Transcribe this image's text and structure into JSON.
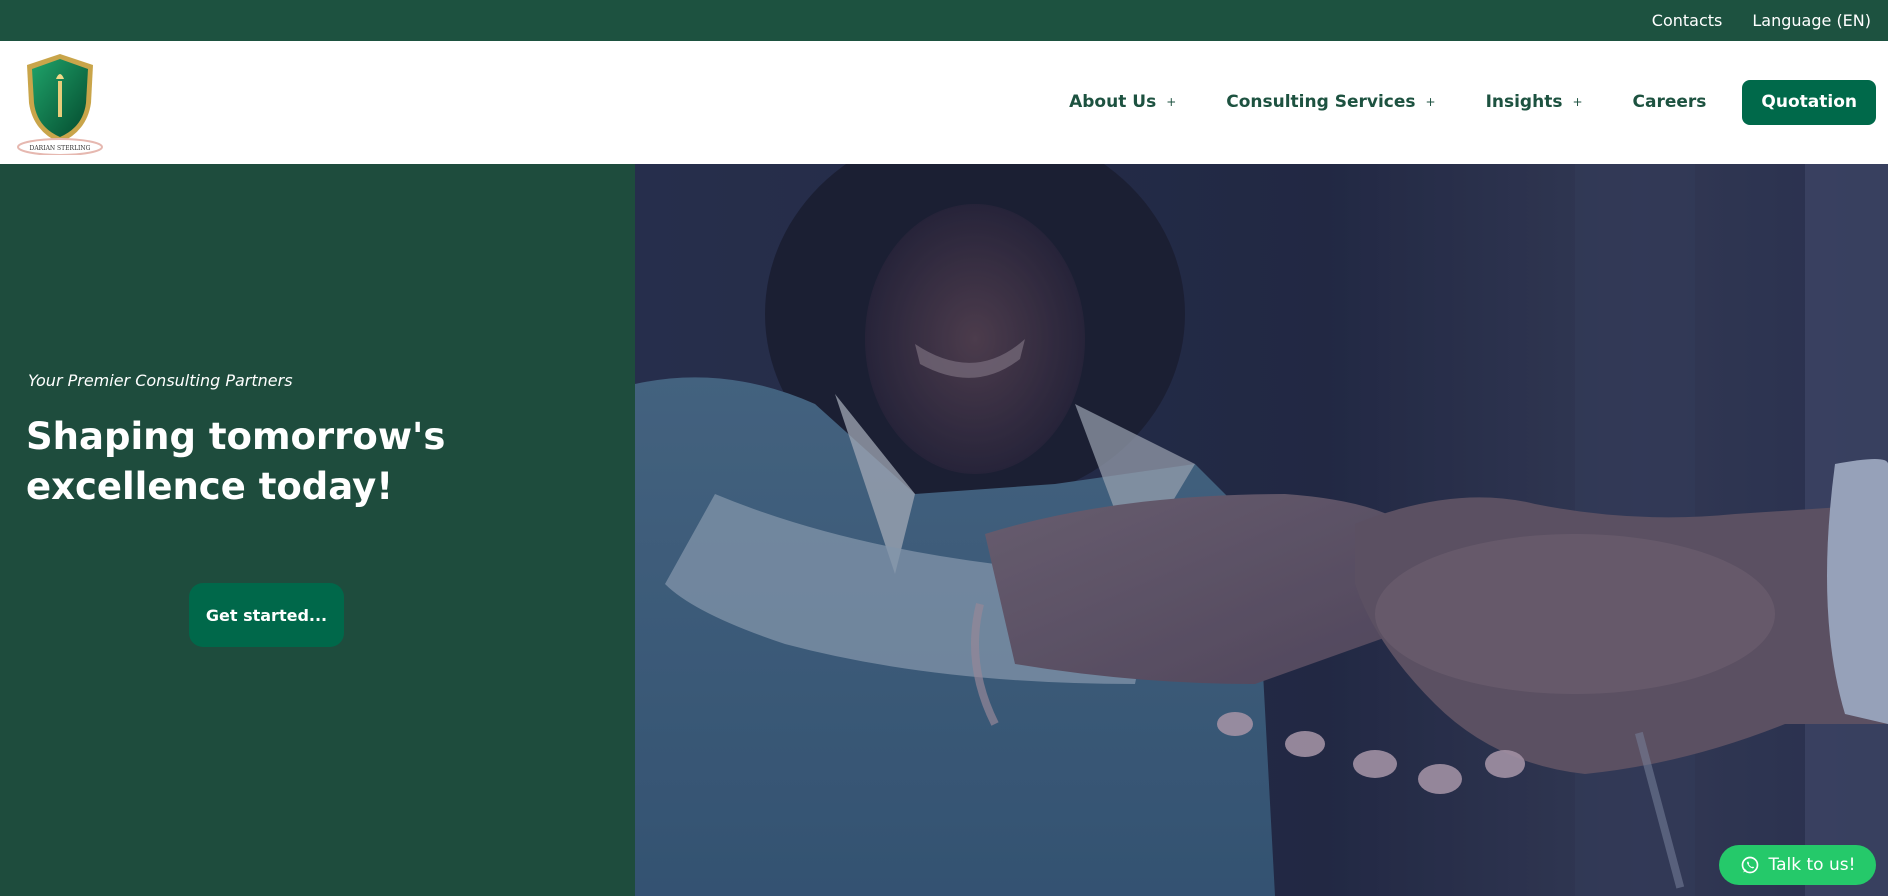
{
  "topbar": {
    "contacts": "Contacts",
    "language": "Language (EN)"
  },
  "brand": {
    "logo_text": "DARIAN STERLING"
  },
  "nav": {
    "items": [
      {
        "label": "About Us",
        "has_submenu": true
      },
      {
        "label": "Consulting Services",
        "has_submenu": true
      },
      {
        "label": "Insights",
        "has_submenu": true
      },
      {
        "label": "Careers",
        "has_submenu": false
      }
    ],
    "submenu_indicator": "+",
    "quotation": "Quotation"
  },
  "hero": {
    "tagline": "Your Premier Consulting Partners",
    "headline": "Shaping tomorrow's excellence today!",
    "cta": "Get started..."
  },
  "chat": {
    "label": "Talk to us!",
    "icon": "whatsapp-icon"
  },
  "colors": {
    "topbar": "#1d5240",
    "hero_panel": "#1e4c3d",
    "primary_button": "#00694a",
    "whatsapp": "#25c96a"
  }
}
